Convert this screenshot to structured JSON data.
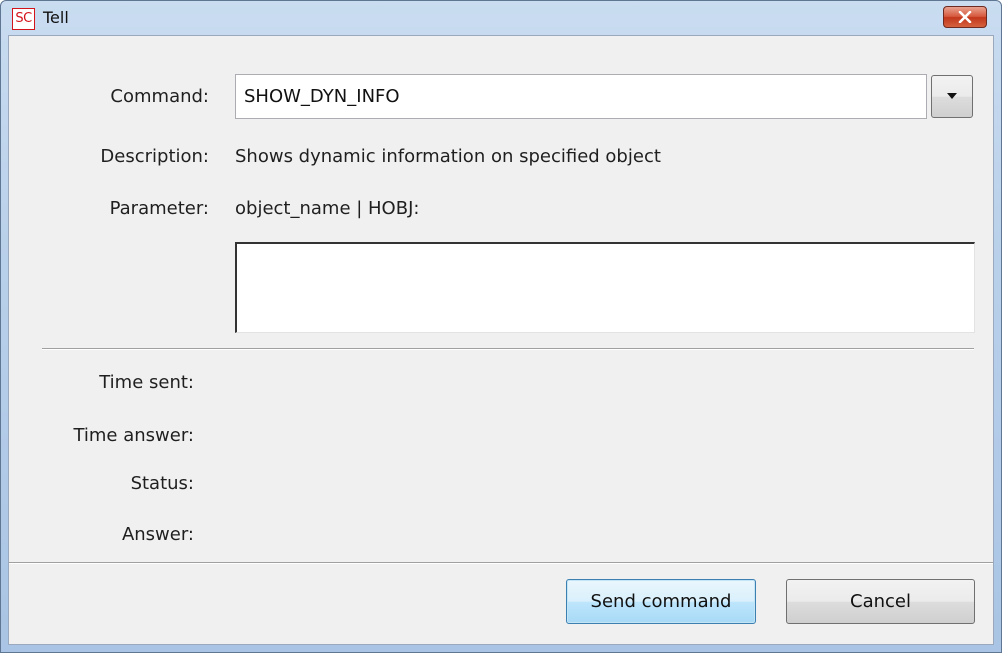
{
  "window": {
    "title": "Tell",
    "app_icon_text": "SC"
  },
  "form": {
    "command_label": "Command:",
    "command_value": "SHOW_DYN_INFO",
    "description_label": "Description:",
    "description_value": "Shows dynamic information on specified object",
    "parameter_label": "Parameter:",
    "parameter_value": "object_name | HOBJ:",
    "parameter_input_value": ""
  },
  "result": {
    "time_sent_label": "Time sent:",
    "time_answer_label": "Time answer:",
    "status_label": "Status:",
    "answer_label": "Answer:"
  },
  "buttons": {
    "send_label": "Send command",
    "cancel_label": "Cancel"
  },
  "icons": {
    "app": "sc-app-icon",
    "close": "close-icon",
    "dropdown": "chevron-down-icon"
  },
  "colors": {
    "title_bar": "#b9d0ea",
    "close_button": "#c2361b",
    "dialog_background": "#f0f0f0",
    "app_icon_red": "#d4141b"
  }
}
